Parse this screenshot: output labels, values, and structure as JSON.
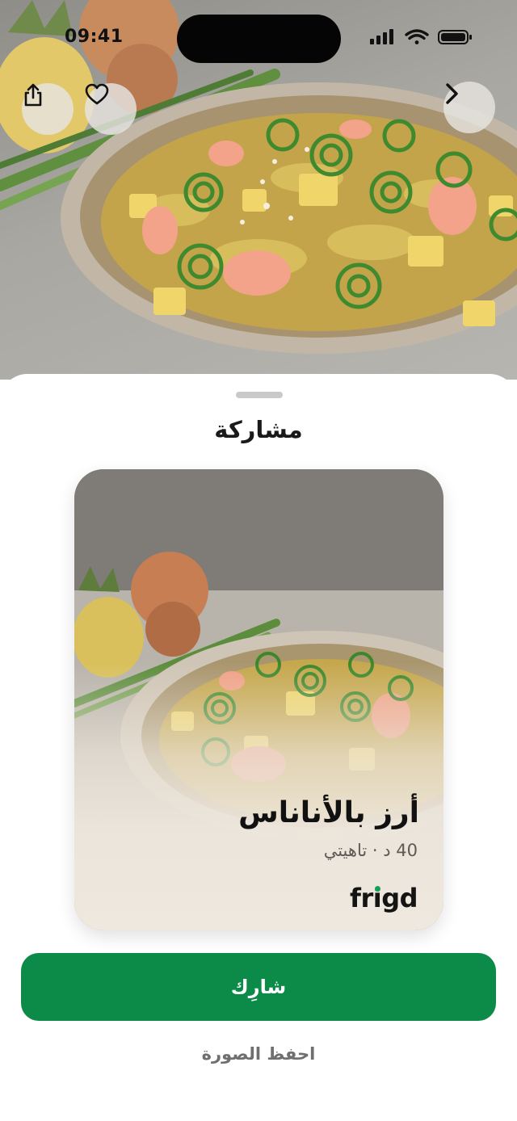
{
  "status_bar": {
    "time": "09:41"
  },
  "hero": {
    "share_icon": "share-icon",
    "favorite_icon": "heart-icon",
    "back_icon": "chevron-right-icon"
  },
  "sheet": {
    "title": "مشاركة",
    "card": {
      "recipe_name": "أرز بالأناناس",
      "meta": "40 د · تاهيتي",
      "brand": {
        "prefix": "fr",
        "i": "i",
        "suffix": "gd"
      }
    },
    "share_button": "شارِك",
    "save_image_link": "احفظ الصورة"
  },
  "colors": {
    "primary": "#0c8a47",
    "brand_dot": "#10a05a"
  }
}
